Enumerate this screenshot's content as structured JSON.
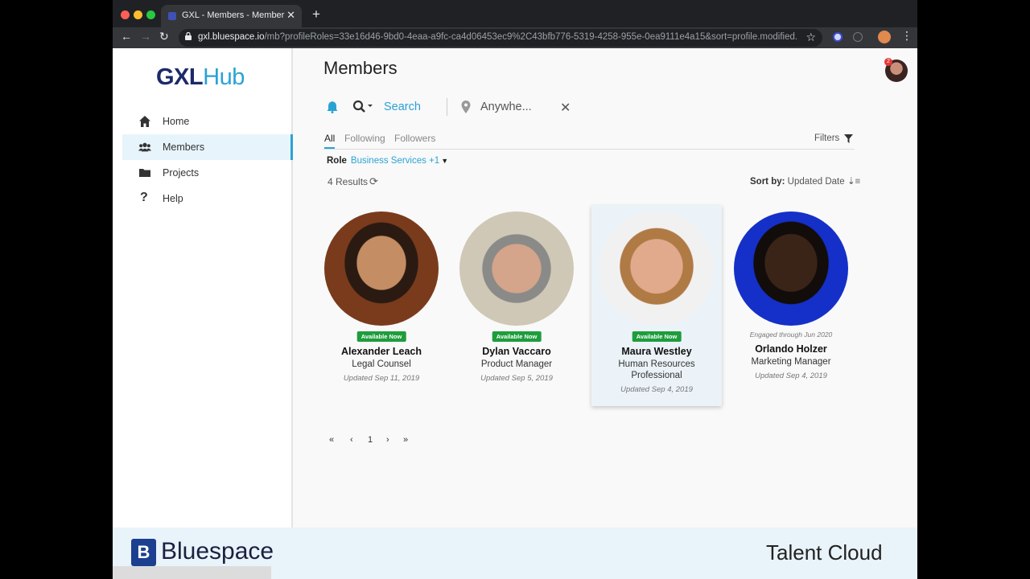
{
  "browser": {
    "tab_title": "GXL - Members - Member List",
    "url_host": "gxl.bluespace.io",
    "url_path": "/mb?profileRoles=33e16d46-9bd0-4eaa-a9fc-ca4d06453ec9%2C43bfb776-5319-4258-955e-0ea9111e4a15&sort=profile.modified..."
  },
  "brand": {
    "part1": "GXL",
    "part2": "Hub"
  },
  "sidebar": {
    "items": [
      {
        "label": "Home",
        "icon": "home-icon"
      },
      {
        "label": "Members",
        "icon": "members-icon",
        "active": true
      },
      {
        "label": "Projects",
        "icon": "folder-icon"
      },
      {
        "label": "Help",
        "icon": "help-icon"
      }
    ]
  },
  "page": {
    "title": "Members",
    "search_label": "Search",
    "location_label": "Anywhe...",
    "tabs": [
      "All",
      "Following",
      "Followers"
    ],
    "filters_label": "Filters",
    "role_key": "Role",
    "role_value": "Business Services +1",
    "results_label": "4 Results",
    "sort_key": "Sort by:",
    "sort_value": "Updated Date",
    "notification_count": "2"
  },
  "members": [
    {
      "status": "Available Now",
      "name": "Alexander Leach",
      "role": "Legal Counsel",
      "updated": "Updated Sep 11, 2019"
    },
    {
      "status": "Available Now",
      "name": "Dylan Vaccaro",
      "role": "Product Manager",
      "updated": "Updated Sep 5, 2019"
    },
    {
      "status": "Available Now",
      "name": "Maura Westley",
      "role": "Human Resources Professional",
      "updated": "Updated Sep 4, 2019"
    },
    {
      "engaged": "Engaged through Jun 2020",
      "name": "Orlando Holzer",
      "role": "Marketing Manager",
      "updated": "Updated Sep 4, 2019"
    }
  ],
  "pager": {
    "first": "«",
    "prev": "‹",
    "current": "1",
    "next": "›",
    "last": "»"
  },
  "footer": {
    "company": "Bluespace",
    "logo_letter": "B",
    "product": "Talent Cloud"
  },
  "colors": {
    "accent": "#2aa3d4",
    "brand_dark": "#1c2a6b",
    "available": "#1e9d3c"
  }
}
